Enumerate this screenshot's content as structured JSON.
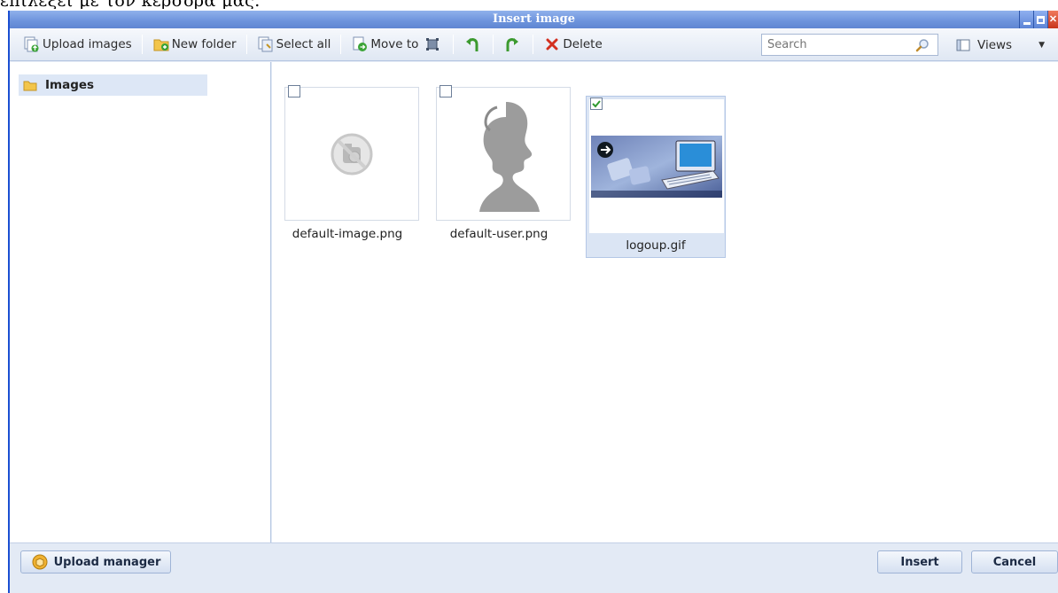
{
  "page_caption": "επιλέξει με τον κέρσορα μας.",
  "window": {
    "title": "Insert image",
    "controls": {
      "minimize": "minimize-icon",
      "maximize": "maximize-icon",
      "close": "close-icon"
    }
  },
  "toolbar": {
    "upload_images": "Upload images",
    "new_folder": "New folder",
    "select_all": "Select all",
    "move_to": "Move to",
    "delete": "Delete",
    "search_placeholder": "Search",
    "views": "Views"
  },
  "sidebar": {
    "folders": [
      {
        "label": "Images",
        "icon": "folder-icon",
        "selected": true
      }
    ]
  },
  "files": [
    {
      "name": "default-image.png",
      "checked": false,
      "selected": false,
      "thumb": "no-image-icon"
    },
    {
      "name": "default-user.png",
      "checked": false,
      "selected": false,
      "thumb": "user-silhouette"
    },
    {
      "name": "logoup.gif",
      "checked": true,
      "selected": true,
      "thumb": "computer-login-image"
    }
  ],
  "footer": {
    "upload_manager": "Upload manager",
    "insert": "Insert",
    "cancel": "Cancel"
  },
  "colors": {
    "accent": "#1b4fd2",
    "titlebar": "#6f95dd",
    "selection": "#dbe5f4",
    "delete_red": "#d3301f"
  }
}
